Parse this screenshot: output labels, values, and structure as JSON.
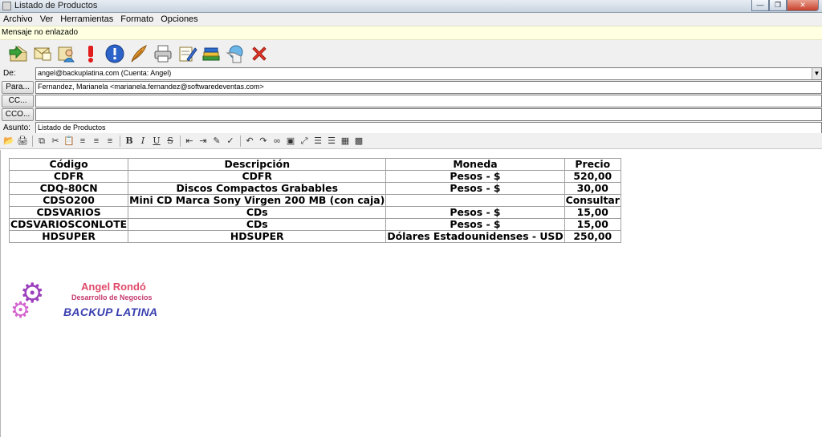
{
  "window": {
    "title": "Listado de Productos"
  },
  "menu": [
    "Archivo",
    "Ver",
    "Herramientas",
    "Formato",
    "Opciones"
  ],
  "message_bar": "Mensaje no enlazado",
  "toolbar_icons": [
    "reply-icon",
    "envelope-icon",
    "contact-icon",
    "priority-high-icon",
    "priority-info-icon",
    "feather-icon",
    "print-icon",
    "edit-icon",
    "books-icon",
    "send-receive-icon",
    "delete-icon"
  ],
  "fields": {
    "from_label": "De:",
    "from_value": "angel@backuplatina.com (Cuenta: Angel)",
    "to_label": "Para...",
    "to_value": "Fernandez, Marianela <marianela.fernandez@softwaredeventas.com>",
    "cc_label": "CC...",
    "cc_value": "",
    "bcc_label": "CCO...",
    "bcc_value": "",
    "subject_label": "Asunto:",
    "subject_value": "Listado de Productos"
  },
  "table": {
    "headers": [
      "Código",
      "Descripción",
      "Moneda",
      "Precio"
    ],
    "rows": [
      [
        "CDFR",
        "CDFR",
        "Pesos - $",
        "520,00"
      ],
      [
        "CDQ-80CN",
        "Discos Compactos Grabables",
        "Pesos - $",
        "30,00"
      ],
      [
        "CDSO200",
        "Mini CD Marca Sony Virgen 200 MB (con caja)",
        "",
        "Consultar"
      ],
      [
        "CDSVARIOS",
        "CDs",
        "Pesos - $",
        "15,00"
      ],
      [
        "CDSVARIOSCONLOTE",
        "CDs",
        "Pesos - $",
        "15,00"
      ],
      [
        "HDSUPER",
        "HDSUPER",
        "Dólares Estadounidenses - USD",
        "250,00"
      ]
    ]
  },
  "signature": {
    "name": "Angel Rondó",
    "role": "Desarrollo de Negocios",
    "company": "BACKUP LATINA"
  }
}
